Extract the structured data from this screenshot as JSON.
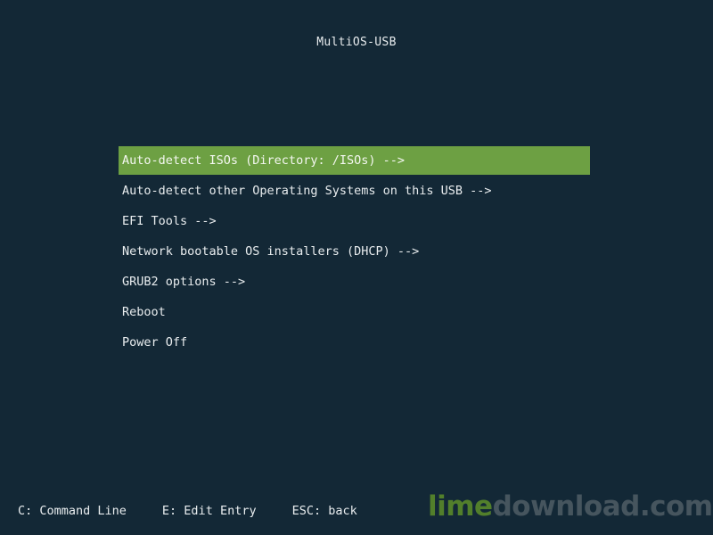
{
  "title": "MultiOS-USB",
  "menu": {
    "items": [
      {
        "label": "Auto-detect ISOs (Directory: /ISOs) -->",
        "selected": true
      },
      {
        "label": "Auto-detect other Operating Systems on this USB -->",
        "selected": false
      },
      {
        "label": "EFI Tools -->",
        "selected": false
      },
      {
        "label": "Network bootable OS installers (DHCP) -->",
        "selected": false
      },
      {
        "label": "GRUB2 options -->",
        "selected": false
      },
      {
        "label": "Reboot",
        "selected": false
      },
      {
        "label": "Power Off",
        "selected": false
      }
    ]
  },
  "footer": {
    "command_line": "C: Command Line",
    "edit_entry": "E: Edit Entry",
    "back": "ESC: back"
  },
  "watermark": {
    "part1": "lime",
    "part2": "download.com"
  },
  "colors": {
    "background": "#132836",
    "selected": "#6da043",
    "text": "#e9edef"
  }
}
